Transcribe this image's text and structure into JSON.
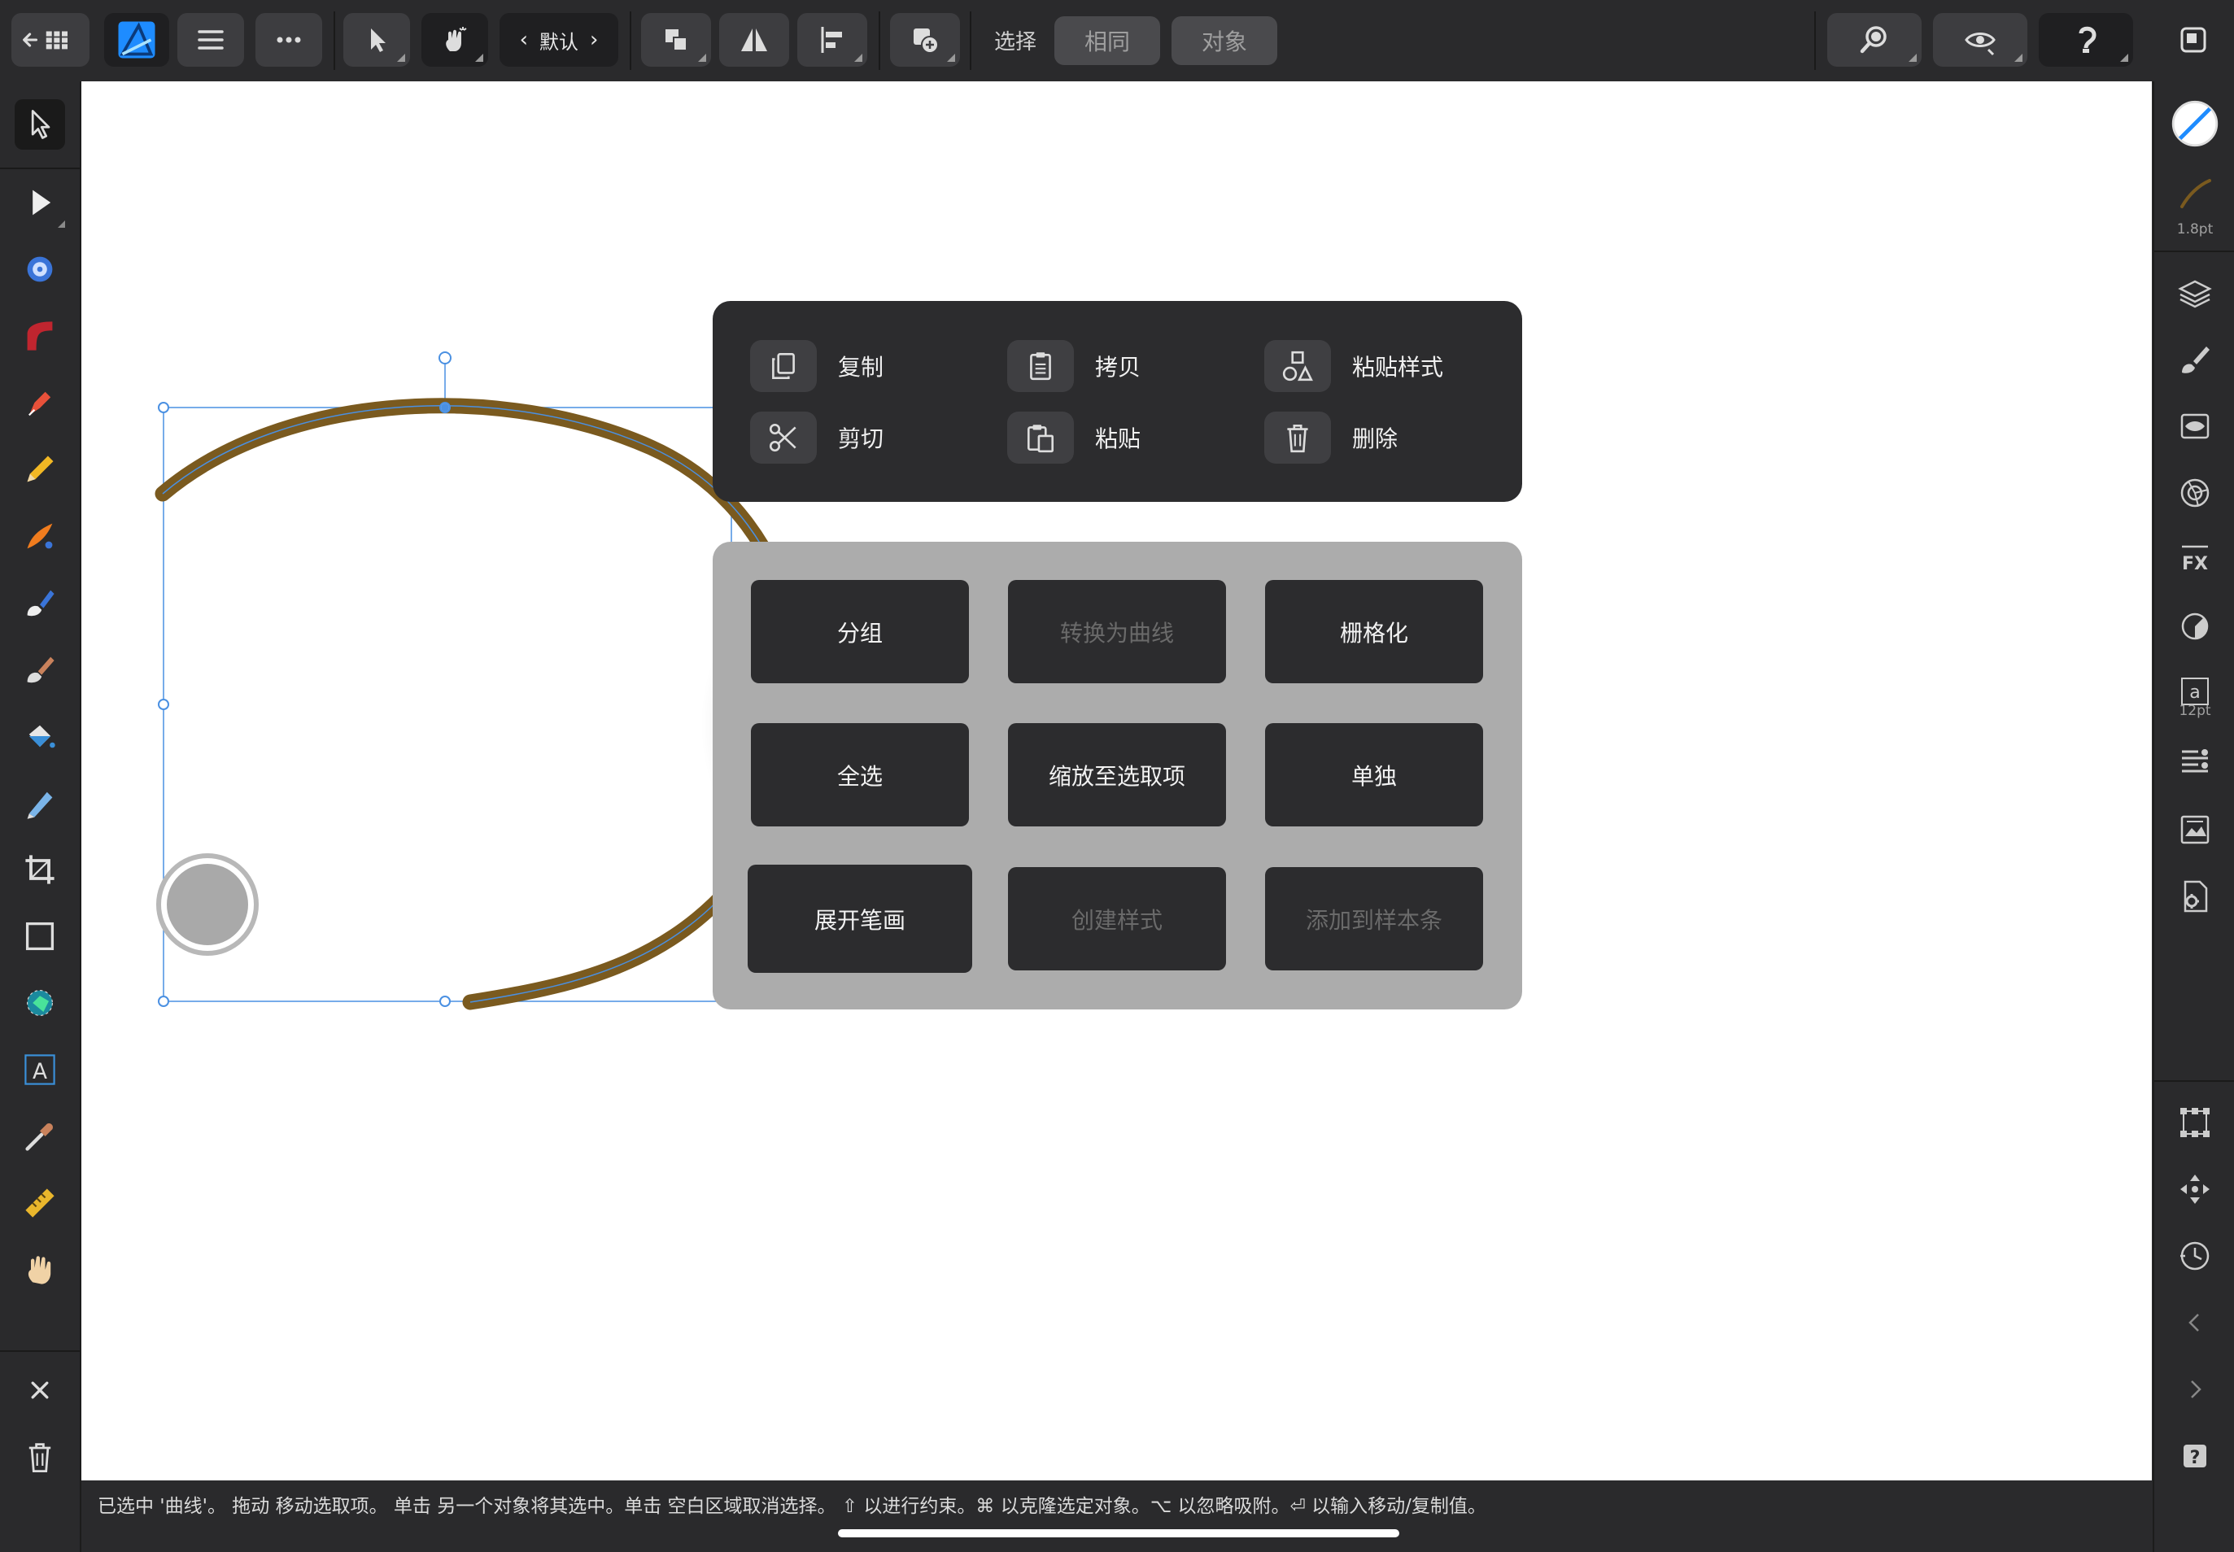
{
  "toolbar": {
    "persona": "默认",
    "select_label": "选择",
    "same_button": "相同",
    "object_button": "对象"
  },
  "right_panel": {
    "stroke_width": "1.8pt",
    "font_size": "12pt"
  },
  "context_menu": {
    "actions": {
      "copy": "复制",
      "duplicate": "拷贝",
      "paste_style": "粘贴样式",
      "cut": "剪切",
      "paste": "粘贴",
      "delete": "删除"
    },
    "commands": {
      "group": "分组",
      "convert_to_curves": "转换为曲线",
      "rasterize": "栅格化",
      "select_all": "全选",
      "zoom_to_selection": "缩放至选取项",
      "isolate": "单独",
      "expand_stroke": "展开笔画",
      "create_style": "创建样式",
      "add_to_swatches": "添加到样本条"
    }
  },
  "status": {
    "hint": "已选中 '曲线'。 拖动 移动选取项。 单击 另一个对象将其选中。单击 空白区域取消选择。 ⇧ 以进行约束。⌘ 以克隆选定对象。⌥ 以忽略吸附。⏎ 以输入移动/复制值。"
  },
  "colors": {
    "accent": "#1e8cff",
    "stroke": "#7a5a1f",
    "panel": "#2c2c2e",
    "menu_bg": "#acacac"
  }
}
